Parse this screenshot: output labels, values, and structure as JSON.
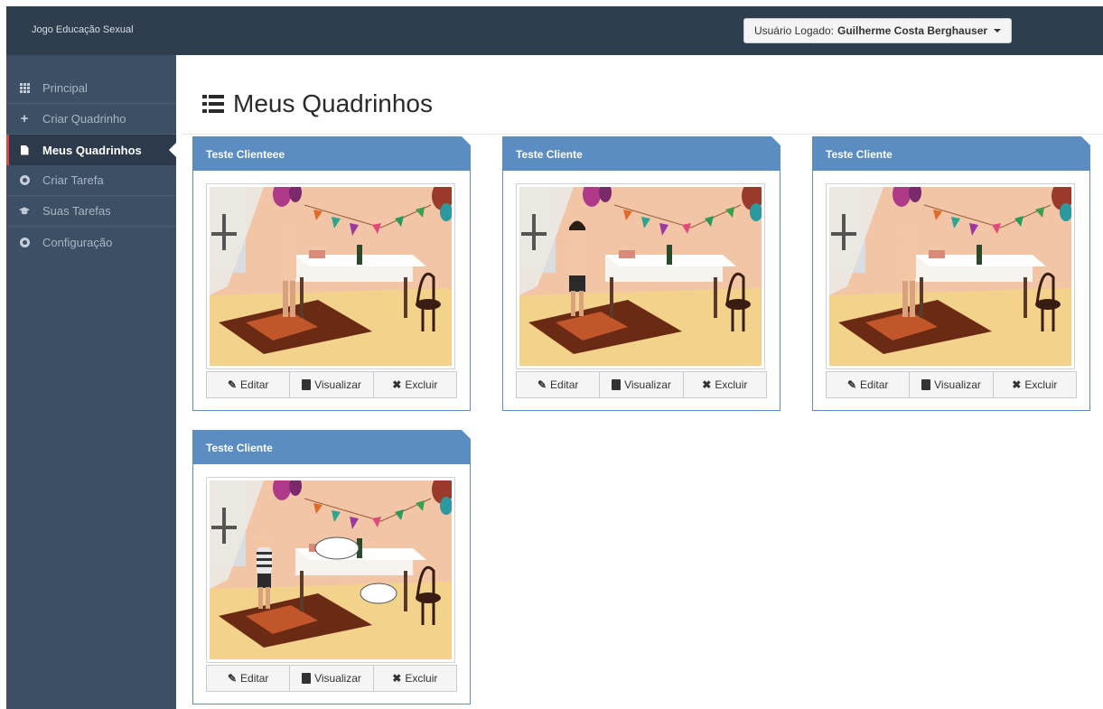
{
  "topbar": {
    "brand": "Jogo Educação Sexual",
    "user_prefix": "Usuário Logado:",
    "user_name": "Guilherme Costa Berghauser"
  },
  "sidebar": {
    "items": [
      {
        "label": "Principal",
        "icon": "grid-icon"
      },
      {
        "label": "Criar Quadrinho",
        "icon": "plus-icon"
      },
      {
        "label": "Meus Quadrinhos",
        "icon": "file-icon",
        "active": true
      },
      {
        "label": "Criar Tarefa",
        "icon": "circle-plus-icon"
      },
      {
        "label": "Suas Tarefas",
        "icon": "graduation-cap-icon"
      },
      {
        "label": "Configuração",
        "icon": "circle-plus-icon"
      }
    ]
  },
  "page": {
    "title": "Meus Quadrinhos"
  },
  "cards": [
    {
      "title": "Teste Clienteee",
      "character": "nude"
    },
    {
      "title": "Teste Cliente",
      "character": "shorts"
    },
    {
      "title": "Teste Cliente",
      "character": "nude"
    },
    {
      "title": "Teste Cliente",
      "character": "striped"
    }
  ],
  "actions": {
    "edit": "Editar",
    "view": "Visualizar",
    "delete": "Excluir"
  },
  "colors": {
    "topbar": "#2e3e4f",
    "sidebar": "#3d4f65",
    "card_header": "#5b8cc2",
    "active_marker": "#e2433f"
  }
}
